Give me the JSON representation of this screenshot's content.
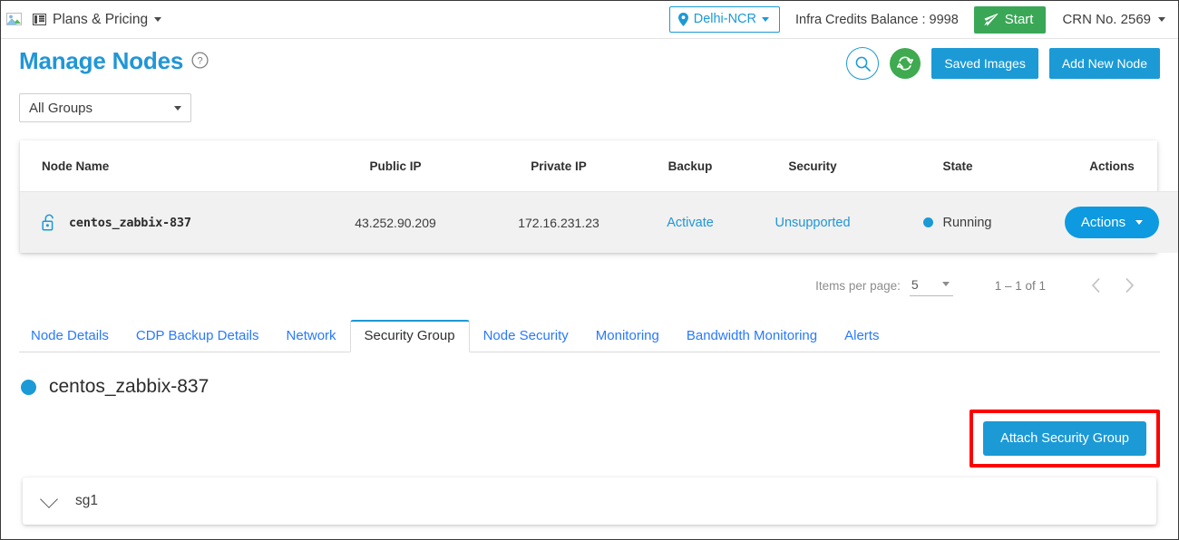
{
  "topbar": {
    "logo_alt": "broken-image",
    "plans_menu": "Plans & Pricing",
    "region": "Delhi-NCR",
    "credits": "Infra Credits Balance : 9998",
    "start_button": "Start",
    "crn": "CRN No. 2569",
    "accent_blue": "#1b9ad6",
    "start_green": "#3aa757"
  },
  "header": {
    "title": "Manage Nodes",
    "help_tooltip": "?",
    "saved_images_button": "Saved Images",
    "add_new_node_button": "Add New Node"
  },
  "filters": {
    "group_select_value": "All Groups"
  },
  "table": {
    "columns": [
      "Node Name",
      "Public IP",
      "Private IP",
      "Backup",
      "Security",
      "State",
      "Actions"
    ],
    "rows": [
      {
        "node_name": "centos_zabbix-837",
        "public_ip": "43.252.90.209",
        "private_ip": "172.16.231.23",
        "backup": "Activate",
        "security": "Unsupported",
        "state": "Running",
        "actions": "Actions"
      }
    ]
  },
  "paginator": {
    "items_per_page_label": "Items per page:",
    "items_per_page_value": "5",
    "range": "1 – 1 of 1"
  },
  "tabs": [
    {
      "label": "Node Details",
      "active": false
    },
    {
      "label": "CDP Backup Details",
      "active": false
    },
    {
      "label": "Network",
      "active": false
    },
    {
      "label": "Security Group",
      "active": true
    },
    {
      "label": "Node Security",
      "active": false
    },
    {
      "label": "Monitoring",
      "active": false
    },
    {
      "label": "Bandwidth Monitoring",
      "active": false
    },
    {
      "label": "Alerts",
      "active": false
    }
  ],
  "security_group_panel": {
    "node_heading": "centos_zabbix-837",
    "attach_button": "Attach Security Group",
    "highlight_color": "#ff0000",
    "groups": [
      {
        "name": "sg1",
        "expanded": false
      }
    ]
  }
}
